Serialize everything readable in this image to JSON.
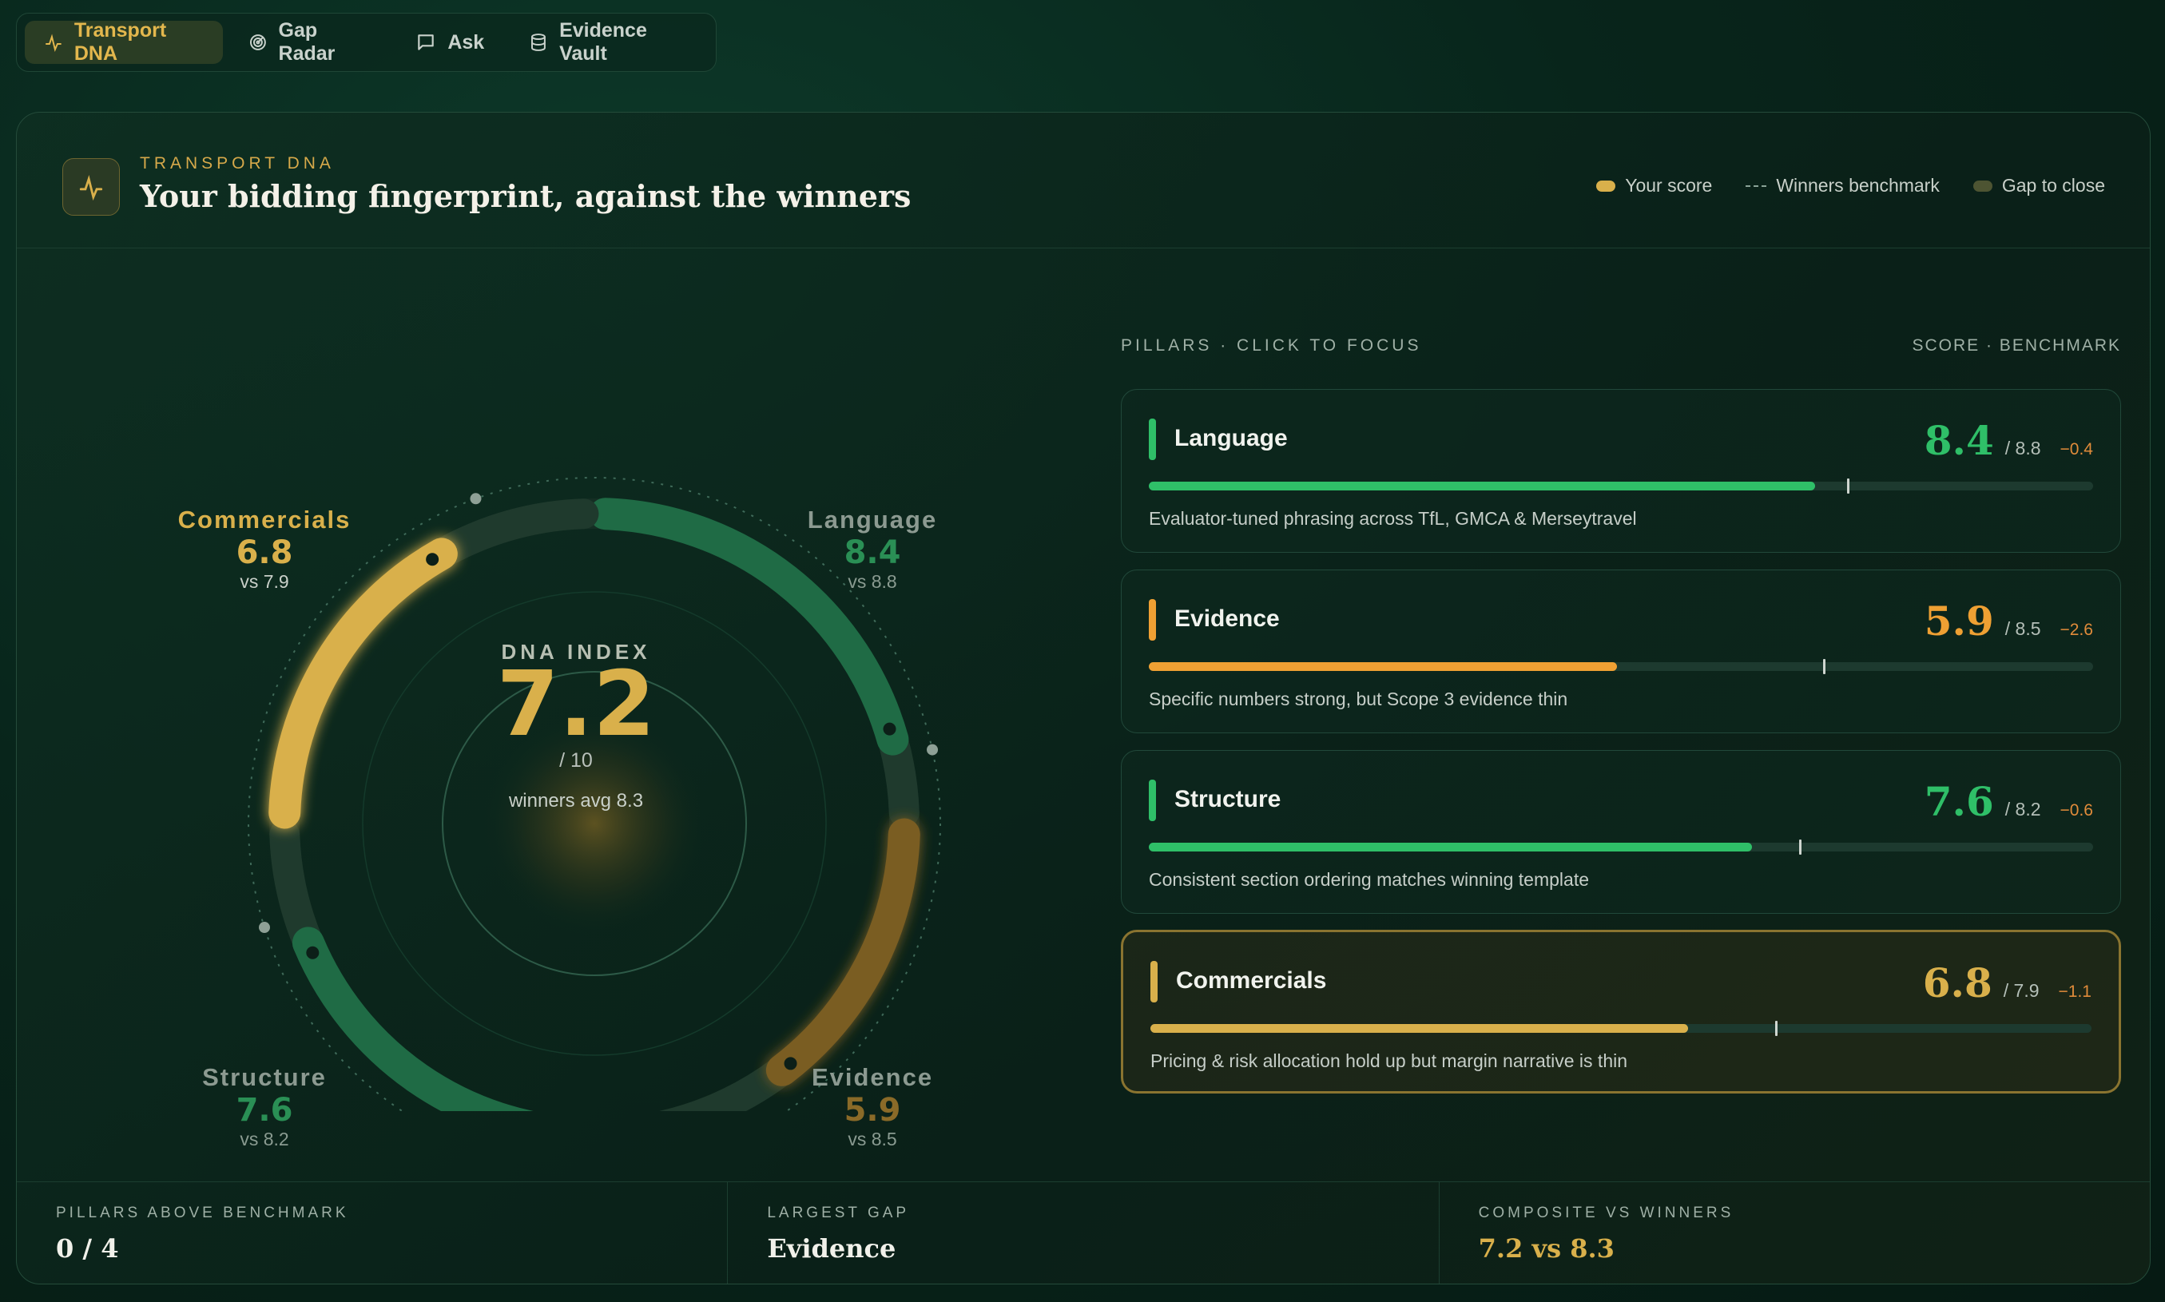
{
  "nav": {
    "tabs": [
      {
        "label": "Transport DNA",
        "icon": "dna-icon",
        "active": true
      },
      {
        "label": "Gap Radar",
        "icon": "radar-icon",
        "active": false
      },
      {
        "label": "Ask",
        "icon": "chat-icon",
        "active": false
      },
      {
        "label": "Evidence Vault",
        "icon": "database-icon",
        "active": false
      }
    ]
  },
  "header": {
    "eyebrow": "TRANSPORT DNA",
    "title": "Your bidding fingerprint, against the winners",
    "legend": {
      "your_score": "Your score",
      "winners_benchmark": "Winners benchmark",
      "gap_to_close": "Gap to close"
    }
  },
  "ring": {
    "center_label": "DNA INDEX",
    "index": "7.2",
    "scale": "/ 10",
    "winners_avg": "winners avg 8.3",
    "labels": {
      "commercials": {
        "name": "Commercials",
        "value": "6.8",
        "vs": "vs 7.9"
      },
      "language": {
        "name": "Language",
        "value": "8.4",
        "vs": "vs 8.8"
      },
      "structure": {
        "name": "Structure",
        "value": "7.6",
        "vs": "vs 8.2"
      },
      "evidence": {
        "name": "Evidence",
        "value": "5.9",
        "vs": "vs 8.5"
      }
    }
  },
  "pillars_header": {
    "left": "PILLARS · CLICK TO FOCUS",
    "right": "SCORE · BENCHMARK"
  },
  "pillars": [
    {
      "name": "Language",
      "score": "8.4",
      "benchmark": "/ 8.8",
      "gap": "−0.4",
      "desc": "Evaluator-tuned phrasing across TfL, GMCA & Merseytravel",
      "score_value": 8.4,
      "benchmark_value": 8.8,
      "color": "#2fbf68"
    },
    {
      "name": "Evidence",
      "score": "5.9",
      "benchmark": "/ 8.5",
      "gap": "−2.6",
      "desc": "Specific numbers strong, but Scope 3 evidence thin",
      "score_value": 5.9,
      "benchmark_value": 8.5,
      "color": "#efa033"
    },
    {
      "name": "Structure",
      "score": "7.6",
      "benchmark": "/ 8.2",
      "gap": "−0.6",
      "desc": "Consistent section ordering matches winning template",
      "score_value": 7.6,
      "benchmark_value": 8.2,
      "color": "#2fbf68"
    },
    {
      "name": "Commercials",
      "score": "6.8",
      "benchmark": "/ 7.9",
      "gap": "−1.1",
      "desc": "Pricing & risk allocation hold up but margin narrative is thin",
      "score_value": 6.8,
      "benchmark_value": 7.9,
      "color": "#d9b04b"
    }
  ],
  "footer": {
    "above_label": "PILLARS ABOVE BENCHMARK",
    "above_value": "0 / 4",
    "gap_label": "LARGEST GAP",
    "gap_value": "Evidence",
    "composite_label": "COMPOSITE VS WINNERS",
    "composite_value": "7.2 vs 8.3"
  },
  "colors": {
    "gold": "#d9b04b",
    "green": "#2fbf68",
    "orange": "#efa033",
    "deep_green": "#1f6b45"
  }
}
